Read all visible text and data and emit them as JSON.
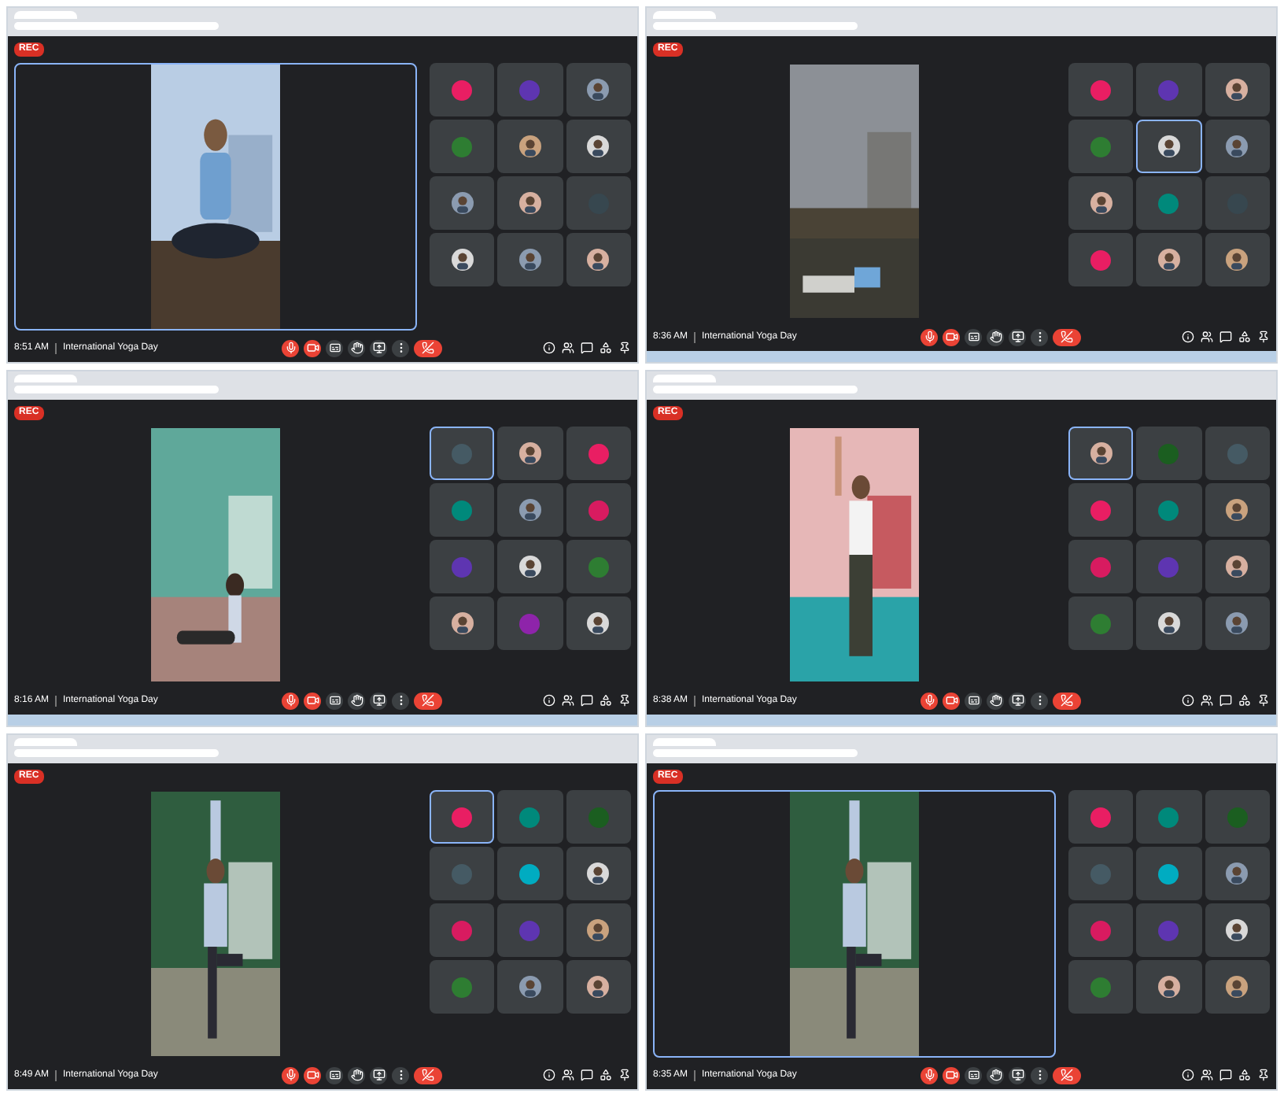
{
  "panels": [
    {
      "rec": "REC",
      "time": "8:51 AM",
      "title": "International Yoga Day",
      "pinned": true,
      "taskbar": false,
      "tiles": [
        {
          "kind": "avatar",
          "color": "#e91e63",
          "selected": false
        },
        {
          "kind": "avatar",
          "color": "#5e35b1",
          "selected": false
        },
        {
          "kind": "picture",
          "selected": false
        },
        {
          "kind": "avatar",
          "color": "#2e7d32",
          "selected": false
        },
        {
          "kind": "picture",
          "selected": false
        },
        {
          "kind": "picture",
          "selected": false
        },
        {
          "kind": "picture",
          "selected": false
        },
        {
          "kind": "picture",
          "selected": false
        },
        {
          "kind": "avatar",
          "color": "#37474f",
          "selected": false
        },
        {
          "kind": "picture",
          "selected": false
        },
        {
          "kind": "picture",
          "selected": false
        },
        {
          "kind": "picture",
          "selected": false
        }
      ]
    },
    {
      "rec": "REC",
      "time": "8:36 AM",
      "title": "International Yoga Day",
      "pinned": false,
      "taskbar": true,
      "tiles": [
        {
          "kind": "avatar",
          "color": "#e91e63",
          "selected": false
        },
        {
          "kind": "avatar",
          "color": "#5e35b1",
          "selected": false
        },
        {
          "kind": "picture",
          "selected": false
        },
        {
          "kind": "avatar",
          "color": "#2e7d32",
          "selected": false
        },
        {
          "kind": "picture",
          "selected": true
        },
        {
          "kind": "picture",
          "selected": false
        },
        {
          "kind": "picture",
          "selected": false
        },
        {
          "kind": "avatar",
          "color": "#00897b",
          "selected": false
        },
        {
          "kind": "avatar",
          "color": "#37474f",
          "selected": false
        },
        {
          "kind": "avatar",
          "color": "#e91e63",
          "selected": false
        },
        {
          "kind": "picture",
          "selected": false
        },
        {
          "kind": "picture",
          "selected": false
        }
      ]
    },
    {
      "rec": "REC",
      "time": "8:16 AM",
      "title": "International Yoga Day",
      "pinned": false,
      "taskbar": true,
      "tiles": [
        {
          "kind": "avatar",
          "color": "#455a64",
          "selected": true
        },
        {
          "kind": "picture",
          "selected": false
        },
        {
          "kind": "avatar",
          "color": "#e91e63",
          "selected": false
        },
        {
          "kind": "avatar",
          "color": "#00897b",
          "selected": false
        },
        {
          "kind": "picture",
          "selected": false
        },
        {
          "kind": "avatar",
          "color": "#d81b60",
          "selected": false
        },
        {
          "kind": "avatar",
          "color": "#5e35b1",
          "selected": false
        },
        {
          "kind": "picture",
          "selected": false
        },
        {
          "kind": "avatar",
          "color": "#2e7d32",
          "selected": false
        },
        {
          "kind": "picture",
          "selected": false
        },
        {
          "kind": "avatar",
          "color": "#8e24aa",
          "selected": false
        },
        {
          "kind": "picture",
          "selected": false
        }
      ]
    },
    {
      "rec": "REC",
      "time": "8:38 AM",
      "title": "International Yoga Day",
      "pinned": false,
      "taskbar": true,
      "tiles": [
        {
          "kind": "picture",
          "selected": true
        },
        {
          "kind": "avatar",
          "color": "#1b5e20",
          "selected": false
        },
        {
          "kind": "avatar",
          "color": "#455a64",
          "selected": false
        },
        {
          "kind": "avatar",
          "color": "#e91e63",
          "selected": false
        },
        {
          "kind": "avatar",
          "color": "#00897b",
          "selected": false
        },
        {
          "kind": "picture",
          "selected": false
        },
        {
          "kind": "avatar",
          "color": "#d81b60",
          "selected": false
        },
        {
          "kind": "avatar",
          "color": "#5e35b1",
          "selected": false
        },
        {
          "kind": "picture",
          "selected": false
        },
        {
          "kind": "avatar",
          "color": "#2e7d32",
          "selected": false
        },
        {
          "kind": "picture",
          "selected": false
        },
        {
          "kind": "picture",
          "selected": false
        }
      ]
    },
    {
      "rec": "REC",
      "time": "8:49 AM",
      "title": "International Yoga Day",
      "pinned": false,
      "taskbar": false,
      "tiles": [
        {
          "kind": "avatar",
          "color": "#e91e63",
          "selected": true
        },
        {
          "kind": "avatar",
          "color": "#00897b",
          "selected": false
        },
        {
          "kind": "avatar",
          "color": "#1b5e20",
          "selected": false
        },
        {
          "kind": "avatar",
          "color": "#455a64",
          "selected": false
        },
        {
          "kind": "avatar",
          "color": "#00acc1",
          "selected": false
        },
        {
          "kind": "picture",
          "selected": false
        },
        {
          "kind": "avatar",
          "color": "#d81b60",
          "selected": false
        },
        {
          "kind": "avatar",
          "color": "#5e35b1",
          "selected": false
        },
        {
          "kind": "picture",
          "selected": false
        },
        {
          "kind": "avatar",
          "color": "#2e7d32",
          "selected": false
        },
        {
          "kind": "picture",
          "selected": false
        },
        {
          "kind": "picture",
          "selected": false
        }
      ]
    },
    {
      "rec": "REC",
      "time": "8:35 AM",
      "title": "International Yoga Day",
      "pinned": true,
      "taskbar": false,
      "tiles": [
        {
          "kind": "avatar",
          "color": "#e91e63",
          "selected": false
        },
        {
          "kind": "avatar",
          "color": "#00897b",
          "selected": false
        },
        {
          "kind": "avatar",
          "color": "#1b5e20",
          "selected": false
        },
        {
          "kind": "avatar",
          "color": "#455a64",
          "selected": false
        },
        {
          "kind": "avatar",
          "color": "#00acc1",
          "selected": false
        },
        {
          "kind": "picture",
          "selected": false
        },
        {
          "kind": "avatar",
          "color": "#d81b60",
          "selected": false
        },
        {
          "kind": "avatar",
          "color": "#5e35b1",
          "selected": false
        },
        {
          "kind": "picture",
          "selected": false
        },
        {
          "kind": "avatar",
          "color": "#2e7d32",
          "selected": false
        },
        {
          "kind": "picture",
          "selected": false
        },
        {
          "kind": "picture",
          "selected": false
        }
      ]
    }
  ]
}
